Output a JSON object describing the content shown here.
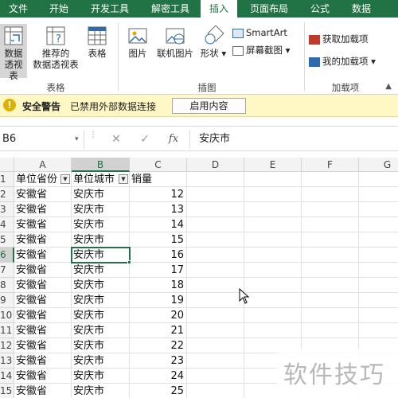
{
  "ribbon": {
    "tabs": [
      {
        "label": "文件",
        "active": false
      },
      {
        "label": "开始",
        "active": false
      },
      {
        "label": "开发工具",
        "active": false
      },
      {
        "label": "解密工具",
        "active": false
      },
      {
        "label": "插入",
        "active": true
      },
      {
        "label": "页面布局",
        "active": false
      },
      {
        "label": "公式",
        "active": false
      },
      {
        "label": "数据",
        "active": false
      }
    ],
    "tables_group": {
      "label": "表格",
      "pivot_table": [
        "数据",
        "透视表"
      ],
      "recommended_pivot": [
        "推荐的",
        "数据透视表"
      ],
      "table": "表格"
    },
    "illustrations_group": {
      "label": "插图",
      "pictures": "图片",
      "online_pictures": "联机图片",
      "shapes": "形状",
      "smartart": "SmartArt",
      "screenshot": "屏幕截图"
    },
    "addins_group": {
      "label": "加载项",
      "get_addins": "获取加载项",
      "my_addins": "我的加载项"
    }
  },
  "security_bar": {
    "title": "安全警告",
    "message": "已禁用外部数据连接",
    "button": "启用内容"
  },
  "formula_bar": {
    "name_box": "B6",
    "formula": "安庆市"
  },
  "sheet": {
    "columns": [
      "A",
      "B",
      "C",
      "D",
      "E",
      "F",
      "G"
    ],
    "selected_column": "B",
    "selected_row": 6,
    "active_cell": "B6",
    "header_row": {
      "a": "单位省份",
      "b": "单位城市",
      "c": "销量"
    },
    "rows": [
      {
        "num": "1",
        "a": "",
        "b": "",
        "c": ""
      },
      {
        "num": "2",
        "a": "安徽省",
        "b": "安庆市",
        "c": "12"
      },
      {
        "num": "3",
        "a": "安徽省",
        "b": "安庆市",
        "c": "13"
      },
      {
        "num": "4",
        "a": "安徽省",
        "b": "安庆市",
        "c": "14"
      },
      {
        "num": "5",
        "a": "安徽省",
        "b": "安庆市",
        "c": "15"
      },
      {
        "num": "6",
        "a": "安徽省",
        "b": "安庆市",
        "c": "16"
      },
      {
        "num": "7",
        "a": "安徽省",
        "b": "安庆市",
        "c": "17"
      },
      {
        "num": "8",
        "a": "安徽省",
        "b": "安庆市",
        "c": "18"
      },
      {
        "num": "9",
        "a": "安徽省",
        "b": "安庆市",
        "c": "19"
      },
      {
        "num": "10",
        "a": "安徽省",
        "b": "安庆市",
        "c": "20"
      },
      {
        "num": "11",
        "a": "安徽省",
        "b": "安庆市",
        "c": "21"
      },
      {
        "num": "12",
        "a": "安徽省",
        "b": "安庆市",
        "c": "22"
      },
      {
        "num": "13",
        "a": "安徽省",
        "b": "安庆市",
        "c": "23"
      },
      {
        "num": "14",
        "a": "安徽省",
        "b": "安庆市",
        "c": "24"
      },
      {
        "num": "15",
        "a": "安徽省",
        "b": "安庆市",
        "c": "25"
      }
    ]
  },
  "watermark": "软件技巧",
  "colors": {
    "accent": "#217346",
    "warning_bar": "#fff8c4",
    "header_bg": "#f3f3f3"
  }
}
